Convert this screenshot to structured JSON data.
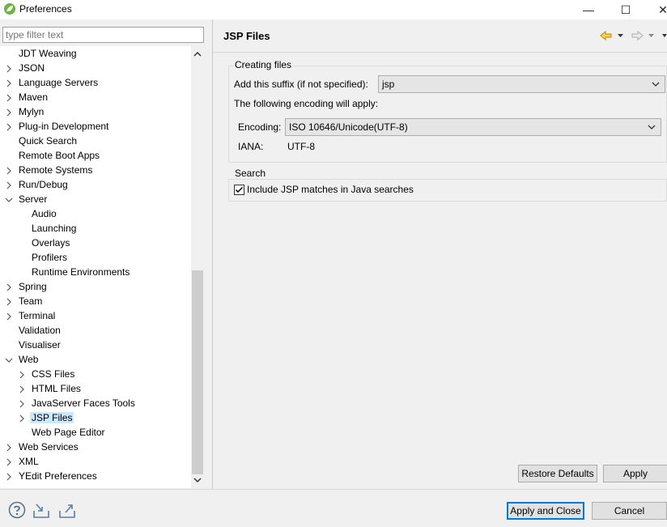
{
  "window": {
    "title": "Preferences",
    "minimize_glyph": "—",
    "maximize_glyph": "☐",
    "close_glyph": "✕"
  },
  "filter": {
    "placeholder": "type filter text",
    "value": ""
  },
  "tree": {
    "items": [
      {
        "label": "JDT Weaving",
        "level": 0,
        "expander": "none"
      },
      {
        "label": "JSON",
        "level": 0,
        "expander": "collapsed"
      },
      {
        "label": "Language Servers",
        "level": 0,
        "expander": "collapsed"
      },
      {
        "label": "Maven",
        "level": 0,
        "expander": "collapsed"
      },
      {
        "label": "Mylyn",
        "level": 0,
        "expander": "collapsed"
      },
      {
        "label": "Plug-in Development",
        "level": 0,
        "expander": "collapsed"
      },
      {
        "label": "Quick Search",
        "level": 0,
        "expander": "none"
      },
      {
        "label": "Remote Boot Apps",
        "level": 0,
        "expander": "none"
      },
      {
        "label": "Remote Systems",
        "level": 0,
        "expander": "collapsed"
      },
      {
        "label": "Run/Debug",
        "level": 0,
        "expander": "collapsed"
      },
      {
        "label": "Server",
        "level": 0,
        "expander": "expanded"
      },
      {
        "label": "Audio",
        "level": 1,
        "expander": "none"
      },
      {
        "label": "Launching",
        "level": 1,
        "expander": "none"
      },
      {
        "label": "Overlays",
        "level": 1,
        "expander": "none"
      },
      {
        "label": "Profilers",
        "level": 1,
        "expander": "none"
      },
      {
        "label": "Runtime Environments",
        "level": 1,
        "expander": "none"
      },
      {
        "label": "Spring",
        "level": 0,
        "expander": "collapsed"
      },
      {
        "label": "Team",
        "level": 0,
        "expander": "collapsed"
      },
      {
        "label": "Terminal",
        "level": 0,
        "expander": "collapsed"
      },
      {
        "label": "Validation",
        "level": 0,
        "expander": "none"
      },
      {
        "label": "Visualiser",
        "level": 0,
        "expander": "none"
      },
      {
        "label": "Web",
        "level": 0,
        "expander": "expanded"
      },
      {
        "label": "CSS Files",
        "level": 1,
        "expander": "collapsed"
      },
      {
        "label": "HTML Files",
        "level": 1,
        "expander": "collapsed"
      },
      {
        "label": "JavaServer Faces Tools",
        "level": 1,
        "expander": "collapsed"
      },
      {
        "label": "JSP Files",
        "level": 1,
        "expander": "collapsed",
        "selected": true
      },
      {
        "label": "Web Page Editor",
        "level": 1,
        "expander": "none"
      },
      {
        "label": "Web Services",
        "level": 0,
        "expander": "collapsed"
      },
      {
        "label": "XML",
        "level": 0,
        "expander": "collapsed"
      },
      {
        "label": "YEdit Preferences",
        "level": 0,
        "expander": "collapsed"
      }
    ]
  },
  "page": {
    "title": "JSP Files",
    "creating_group": {
      "title": "Creating files",
      "suffix_label": "Add this suffix (if not specified):",
      "suffix_value": "jsp",
      "encoding_note": "The following encoding will apply:",
      "encoding_label": "Encoding:",
      "encoding_value": "ISO 10646/Unicode(UTF-8)",
      "iana_label": "IANA:",
      "iana_value": "UTF-8"
    },
    "search_group": {
      "title": "Search",
      "checkbox_label": "Include JSP matches in Java searches",
      "checked": true
    },
    "restore_defaults": "Restore Defaults",
    "apply": "Apply"
  },
  "footer": {
    "apply_close": "Apply and Close",
    "cancel": "Cancel"
  },
  "colors": {
    "accent": "#0078d7",
    "selection": "#cce8ff",
    "nav_arrow": "#e8a800"
  }
}
